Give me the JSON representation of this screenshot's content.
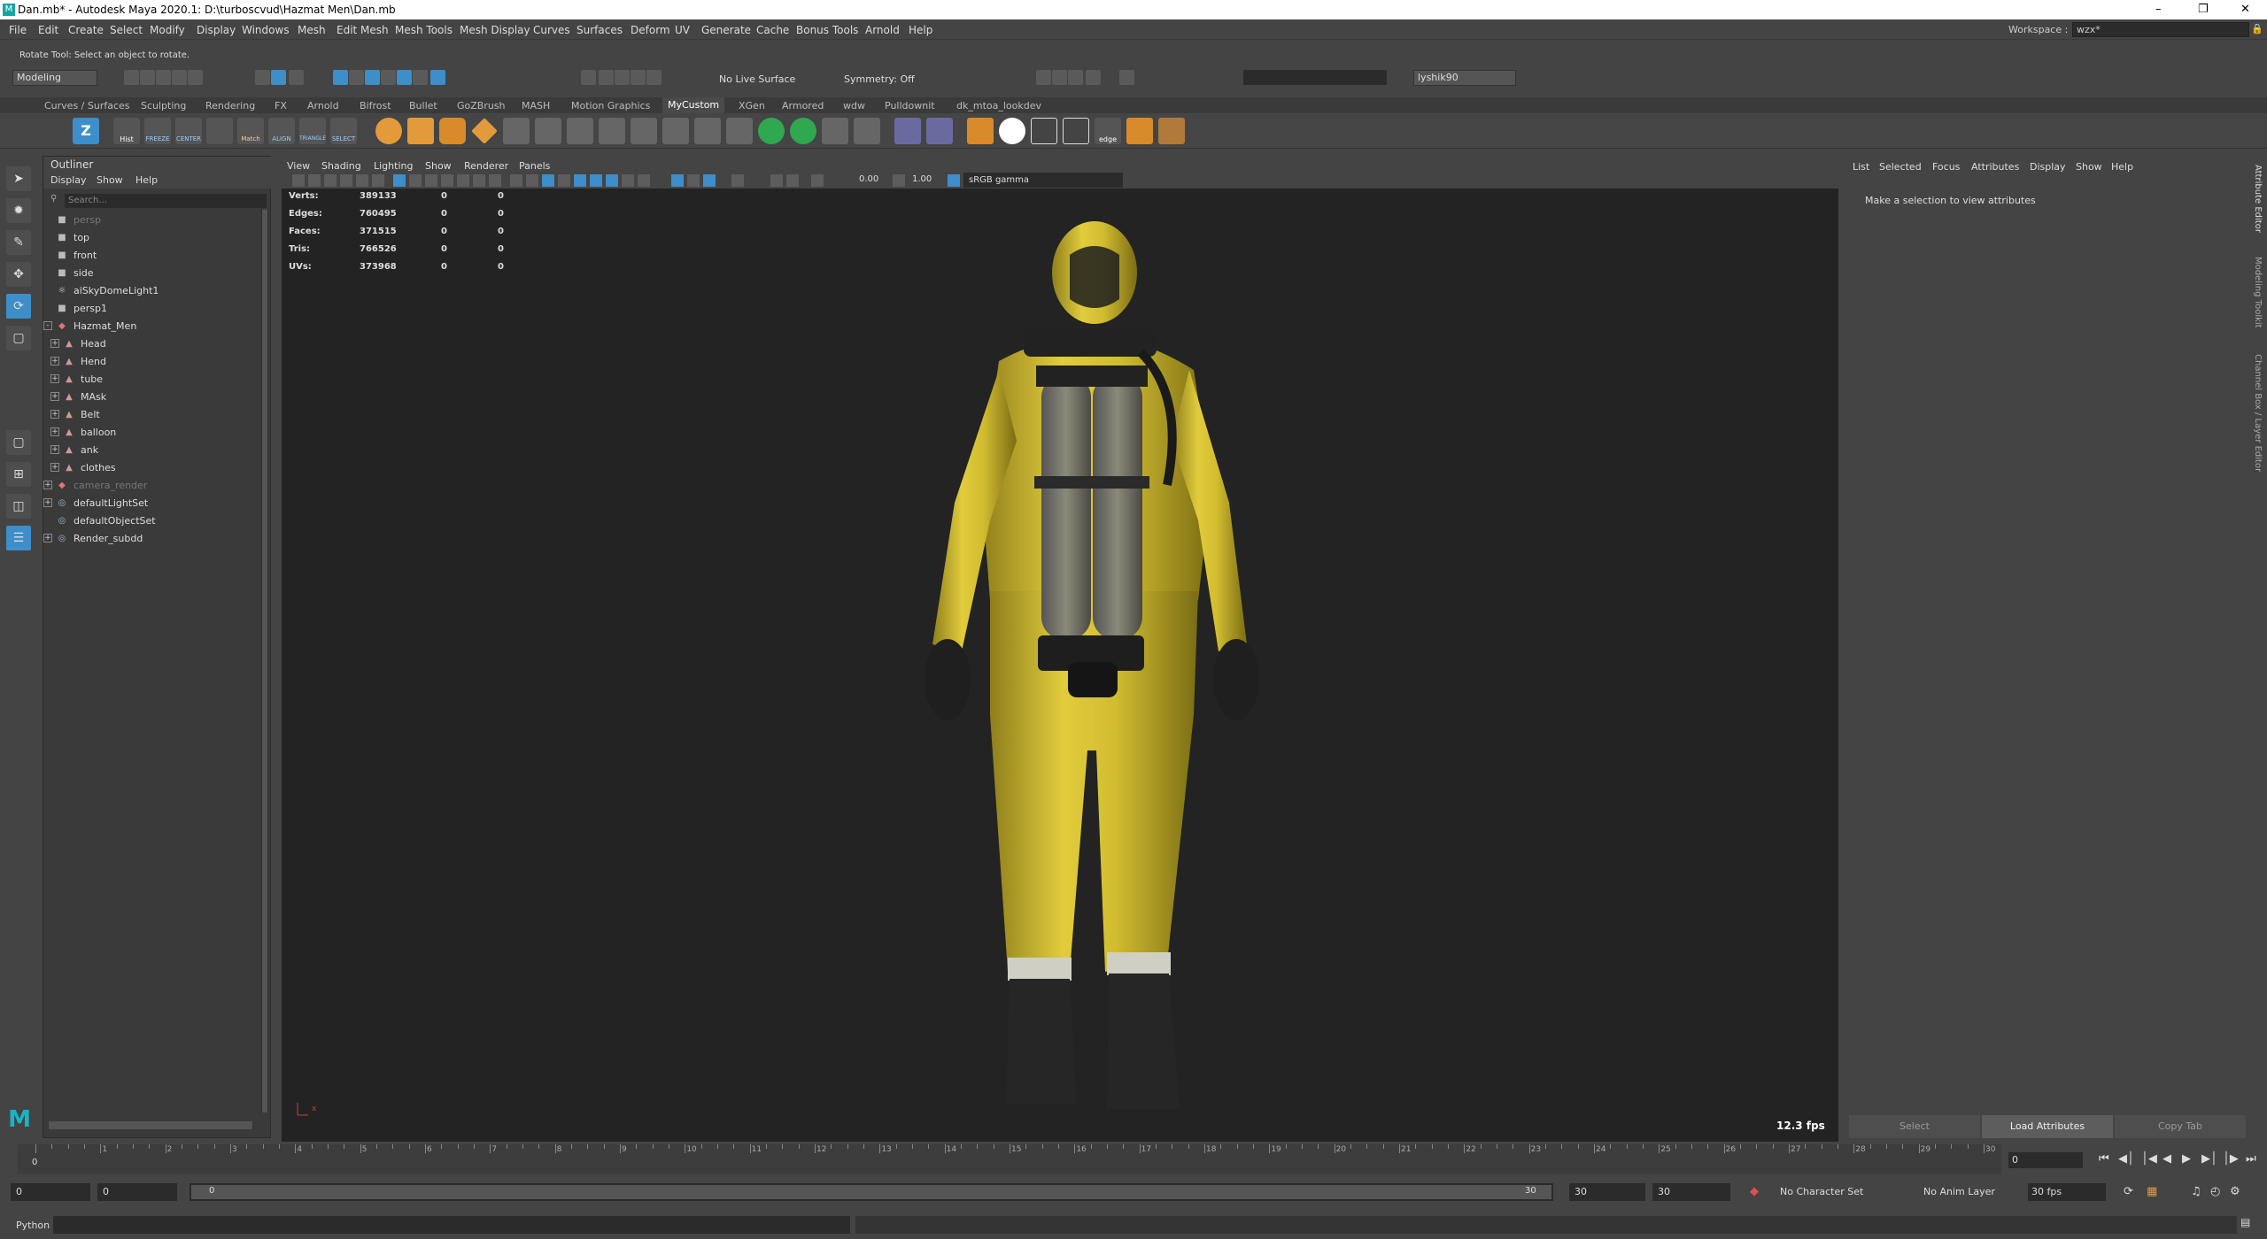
{
  "title": "Dan.mb* - Autodesk Maya 2020.1: D:\\turboscvud\\Hazmat Men\\Dan.mb",
  "menu": [
    "File",
    "Edit",
    "Create",
    "Select",
    "Modify",
    "Display",
    "Windows",
    "Mesh",
    "Edit Mesh",
    "Mesh Tools",
    "Mesh Display",
    "Curves",
    "Surfaces",
    "Deform",
    "UV",
    "Generate",
    "Cache",
    "Bonus Tools",
    "Arnold",
    "Help"
  ],
  "workspace": {
    "label": "Workspace :",
    "value": "wzx*"
  },
  "status": {
    "mode": "Modeling",
    "live_surface": "No Live Surface",
    "symmetry": "Symmetry: Off",
    "user": "lyshik90"
  },
  "helpline": "Rotate Tool: Select an object to rotate.",
  "shelf_tabs": [
    "Curves / Surfaces",
    "Sculpting",
    "Rendering",
    "FX",
    "Arnold",
    "Bifrost",
    "Bullet",
    "GoZBrush",
    "MASH",
    "Motion Graphics",
    "MyCustom",
    "XGen",
    "Armored",
    "wdw",
    "Pulldownit",
    "dk_mtoa_lookdev"
  ],
  "shelf_active": "MyCustom",
  "shelf_labels": [
    "Hist",
    "FREEZE",
    "CENTER",
    "",
    "Match",
    "ALIGN",
    "TRIANGLE",
    "SELECT",
    "edge"
  ],
  "outliner": {
    "title": "Outliner",
    "menus": [
      "Display",
      "Show",
      "Help"
    ],
    "search_placeholder": "Search...",
    "items": [
      {
        "label": "persp",
        "dim": true,
        "icon": "camera"
      },
      {
        "label": "top",
        "icon": "camera"
      },
      {
        "label": "front",
        "icon": "camera"
      },
      {
        "label": "side",
        "icon": "camera"
      },
      {
        "label": "aiSkyDomeLight1",
        "icon": "light"
      },
      {
        "label": "persp1",
        "icon": "camera"
      },
      {
        "label": "Hazmat_Men",
        "icon": "group",
        "expand": "-"
      },
      {
        "label": "Head",
        "icon": "mesh",
        "expand": "+",
        "child": true
      },
      {
        "label": "Hend",
        "icon": "mesh",
        "expand": "+",
        "child": true
      },
      {
        "label": "tube",
        "icon": "mesh",
        "expand": "+",
        "child": true
      },
      {
        "label": "MAsk",
        "icon": "mesh",
        "expand": "+",
        "child": true
      },
      {
        "label": "Belt",
        "icon": "mesh",
        "expand": "+",
        "child": true
      },
      {
        "label": "balloon",
        "icon": "mesh",
        "expand": "+",
        "child": true
      },
      {
        "label": "ank",
        "icon": "mesh",
        "expand": "+",
        "child": true
      },
      {
        "label": "clothes",
        "icon": "mesh",
        "expand": "+",
        "child": true
      },
      {
        "label": "camera_render",
        "icon": "group",
        "expand": "+",
        "dim": true
      },
      {
        "label": "defaultLightSet",
        "icon": "set",
        "expand": "+"
      },
      {
        "label": "defaultObjectSet",
        "icon": "set"
      },
      {
        "label": "Render_subdd",
        "icon": "set",
        "expand": "+"
      }
    ]
  },
  "viewport": {
    "menus": [
      "View",
      "Shading",
      "Lighting",
      "Show",
      "Renderer",
      "Panels"
    ],
    "exposure": "0.00",
    "gamma": "1.00",
    "colorspace": "sRGB gamma",
    "hud": [
      {
        "label": "Verts:",
        "v1": "389133",
        "v2": "0",
        "v3": "0"
      },
      {
        "label": "Edges:",
        "v1": "760495",
        "v2": "0",
        "v3": "0"
      },
      {
        "label": "Faces:",
        "v1": "371515",
        "v2": "0",
        "v3": "0"
      },
      {
        "label": "Tris:",
        "v1": "766526",
        "v2": "0",
        "v3": "0"
      },
      {
        "label": "UVs:",
        "v1": "373968",
        "v2": "0",
        "v3": "0"
      }
    ],
    "fps": "12.3 fps",
    "axis_label": "x"
  },
  "attribute_editor": {
    "menus": [
      "List",
      "Selected",
      "Focus",
      "Attributes",
      "Display",
      "Show",
      "Help"
    ],
    "message": "Make a selection to view attributes",
    "buttons": [
      "Select",
      "Load Attributes",
      "Copy Tab"
    ]
  },
  "side_tabs": [
    "Attribute Editor",
    "Modeling Toolkit",
    "Channel Box / Layer Editor"
  ],
  "timeline": {
    "ticks": [
      "1",
      "2",
      "3",
      "4",
      "5",
      "6",
      "7",
      "8",
      "9",
      "10",
      "11",
      "12",
      "13",
      "14",
      "15",
      "16",
      "17",
      "18",
      "19",
      "20",
      "21",
      "22",
      "23",
      "24",
      "25",
      "26",
      "27",
      "28",
      "29",
      "30"
    ],
    "current_marker": "0",
    "current_frame": "0"
  },
  "range": {
    "start": "0",
    "anim_start": "0",
    "range_start": "0",
    "range_end": "30",
    "anim_end": "30",
    "end": "30",
    "character_set": "No Character Set",
    "anim_layer": "No Anim Layer",
    "fps": "30 fps"
  },
  "command_line": {
    "label": "Python"
  },
  "colors": {
    "accent": "#3d8ec9",
    "suit": "#d9c232",
    "viewport_bg": "#232323",
    "maya_logo": "#16b6c6"
  }
}
